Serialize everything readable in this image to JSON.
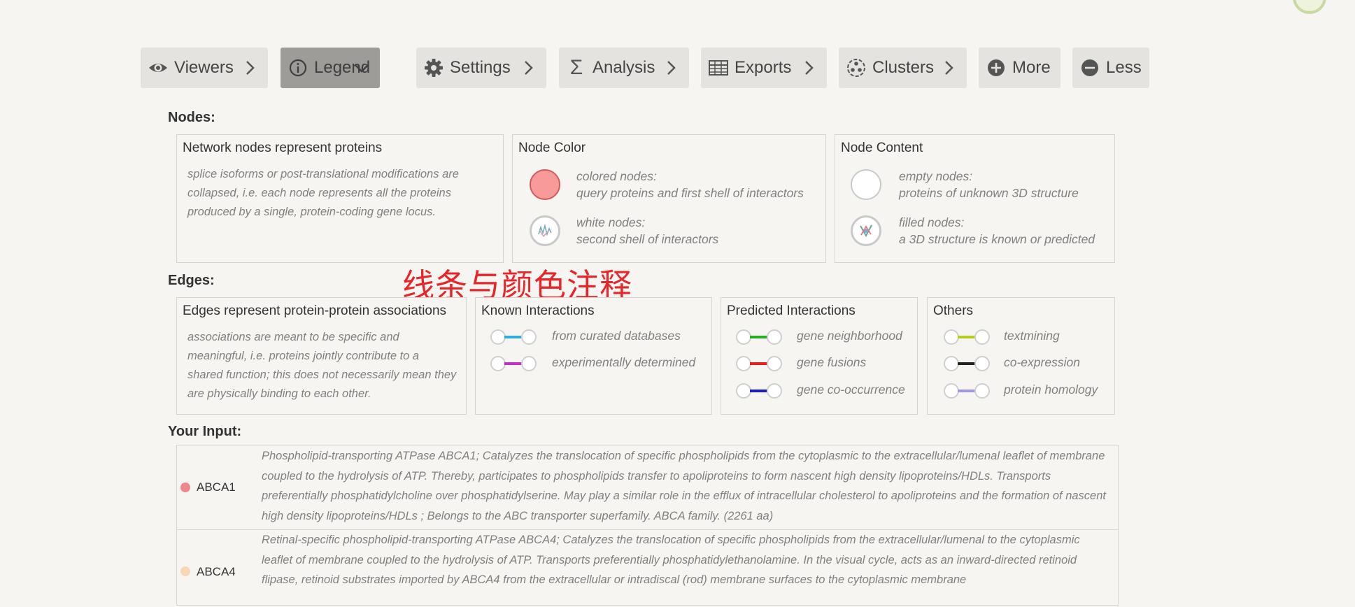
{
  "toolbar": {
    "viewers": "Viewers",
    "legend": "Legend",
    "settings": "Settings",
    "analysis": "Analysis",
    "exports": "Exports",
    "clusters": "Clusters",
    "more": "More",
    "less": "Less"
  },
  "nodes": {
    "heading": "Nodes:",
    "proteins": {
      "title": "Network nodes represent proteins",
      "desc": "splice isoforms or post-translational modifications are collapsed, i.e. each node represents all the proteins produced by a single, protein-coding gene locus."
    },
    "color": {
      "title": "Node Color",
      "colored_label": "colored nodes:",
      "colored_desc": "query proteins and first shell of interactors",
      "white_label": "white nodes:",
      "white_desc": "second shell of interactors"
    },
    "content": {
      "title": "Node Content",
      "empty_label": "empty nodes:",
      "empty_desc": "proteins of unknown 3D structure",
      "filled_label": "filled nodes:",
      "filled_desc": "a 3D structure is known or predicted"
    }
  },
  "edges": {
    "heading": "Edges:",
    "assoc": {
      "title": "Edges represent protein-protein associations",
      "desc": "associations are meant to be specific and meaningful, i.e. proteins jointly contribute to a shared function; this does not necessarily mean they are physically binding to each other."
    },
    "known": {
      "title": "Known Interactions",
      "items": [
        {
          "label": "from curated databases",
          "color": "#2dade0"
        },
        {
          "label": "experimentally determined",
          "color": "#c42fc4"
        }
      ]
    },
    "predicted": {
      "title": "Predicted Interactions",
      "items": [
        {
          "label": "gene neighborhood",
          "color": "#22b022"
        },
        {
          "label": "gene fusions",
          "color": "#e8211d"
        },
        {
          "label": "gene co-occurrence",
          "color": "#1b1bd4"
        }
      ]
    },
    "others": {
      "title": "Others",
      "items": [
        {
          "label": "textmining",
          "color": "#b5cc1e"
        },
        {
          "label": "co-expression",
          "color": "#222222"
        },
        {
          "label": "protein homology",
          "color": "#9d95ee"
        }
      ]
    }
  },
  "annotation": "线条与颜色注释",
  "your_input": {
    "heading": "Your Input:",
    "rows": [
      {
        "name": "ABCA1",
        "dot_color": "#f0878a",
        "desc": "Phospholipid-transporting ATPase ABCA1; Catalyzes the translocation of specific phospholipids from the cytoplasmic to the extracellular/lumenal leaflet of membrane coupled to the hydrolysis of ATP. Thereby, participates to phospholipids transfer to apoliproteins to form nascent high density lipoproteins/HDLs. Transports preferentially phosphatidylcholine over phosphatidylserine. May play a similar role in the efflux of intracellular cholesterol to apoliproteins and the formation of nascent high density lipoproteins/HDLs ; Belongs to the ABC transporter superfamily. ABCA family. (2261 aa)"
      },
      {
        "name": "ABCA4",
        "dot_color": "#fbd6b4",
        "desc": "Retinal-specific phospholipid-transporting ATPase ABCA4; Catalyzes the translocation of specific phospholipids from the extracellular/lumenal to the cytoplasmic leaflet of membrane coupled to the hydrolysis of ATP. Transports preferentially phosphatidylethanolamine. In the visual cycle, acts as an inward-directed retinoid flipase, retinoid substrates imported by ABCA4 from the extracellular or intradiscal (rod) membrane surfaces to the cytoplasmic membrane"
      }
    ]
  },
  "colors": {
    "colored_node": "#f99a9a",
    "toolbar_bg": "#e4e3e0",
    "toolbar_active_bg": "#9d9c99"
  }
}
